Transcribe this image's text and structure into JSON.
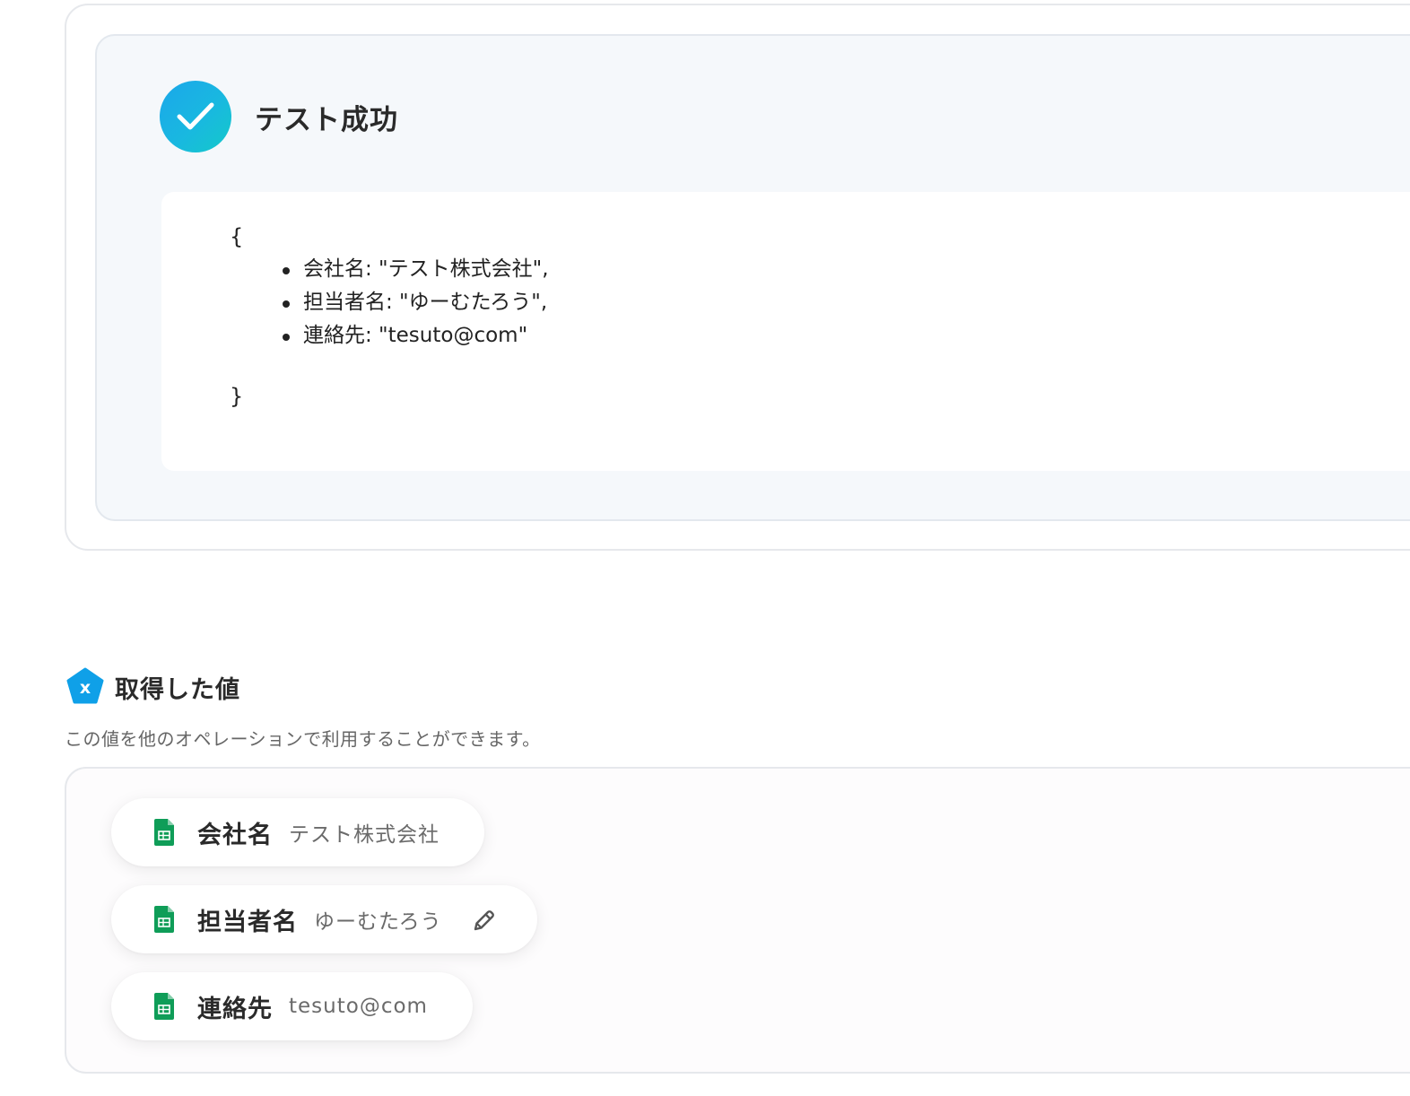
{
  "test_result": {
    "title": "テスト成功",
    "open_brace": "{",
    "close_brace": "}",
    "items": [
      "会社名: \"テスト株式会社\",",
      "担当者名: \"ゆーむたろう\",",
      "連絡先: \"tesuto@com\""
    ]
  },
  "acquired_values": {
    "heading": "取得した値",
    "description": "この値を他のオペレーションで利用することができます。",
    "icon_glyph": "x",
    "items": [
      {
        "label": "会社名",
        "value": "テスト株式会社",
        "icon": "google-sheets-icon"
      },
      {
        "label": "担当者名",
        "value": "ゆーむたろう",
        "icon": "google-sheets-icon",
        "action_icon": "pencil-edit-icon"
      },
      {
        "label": "連絡先",
        "value": "tesuto@com",
        "icon": "google-sheets-icon"
      }
    ]
  },
  "colors": {
    "success_gradient_start": "#1ba7ea",
    "success_gradient_end": "#14c9c9",
    "variable_icon": "#0fa0e8",
    "sheets_green": "#0f9d58",
    "panel_bg": "#f5f8fb"
  }
}
